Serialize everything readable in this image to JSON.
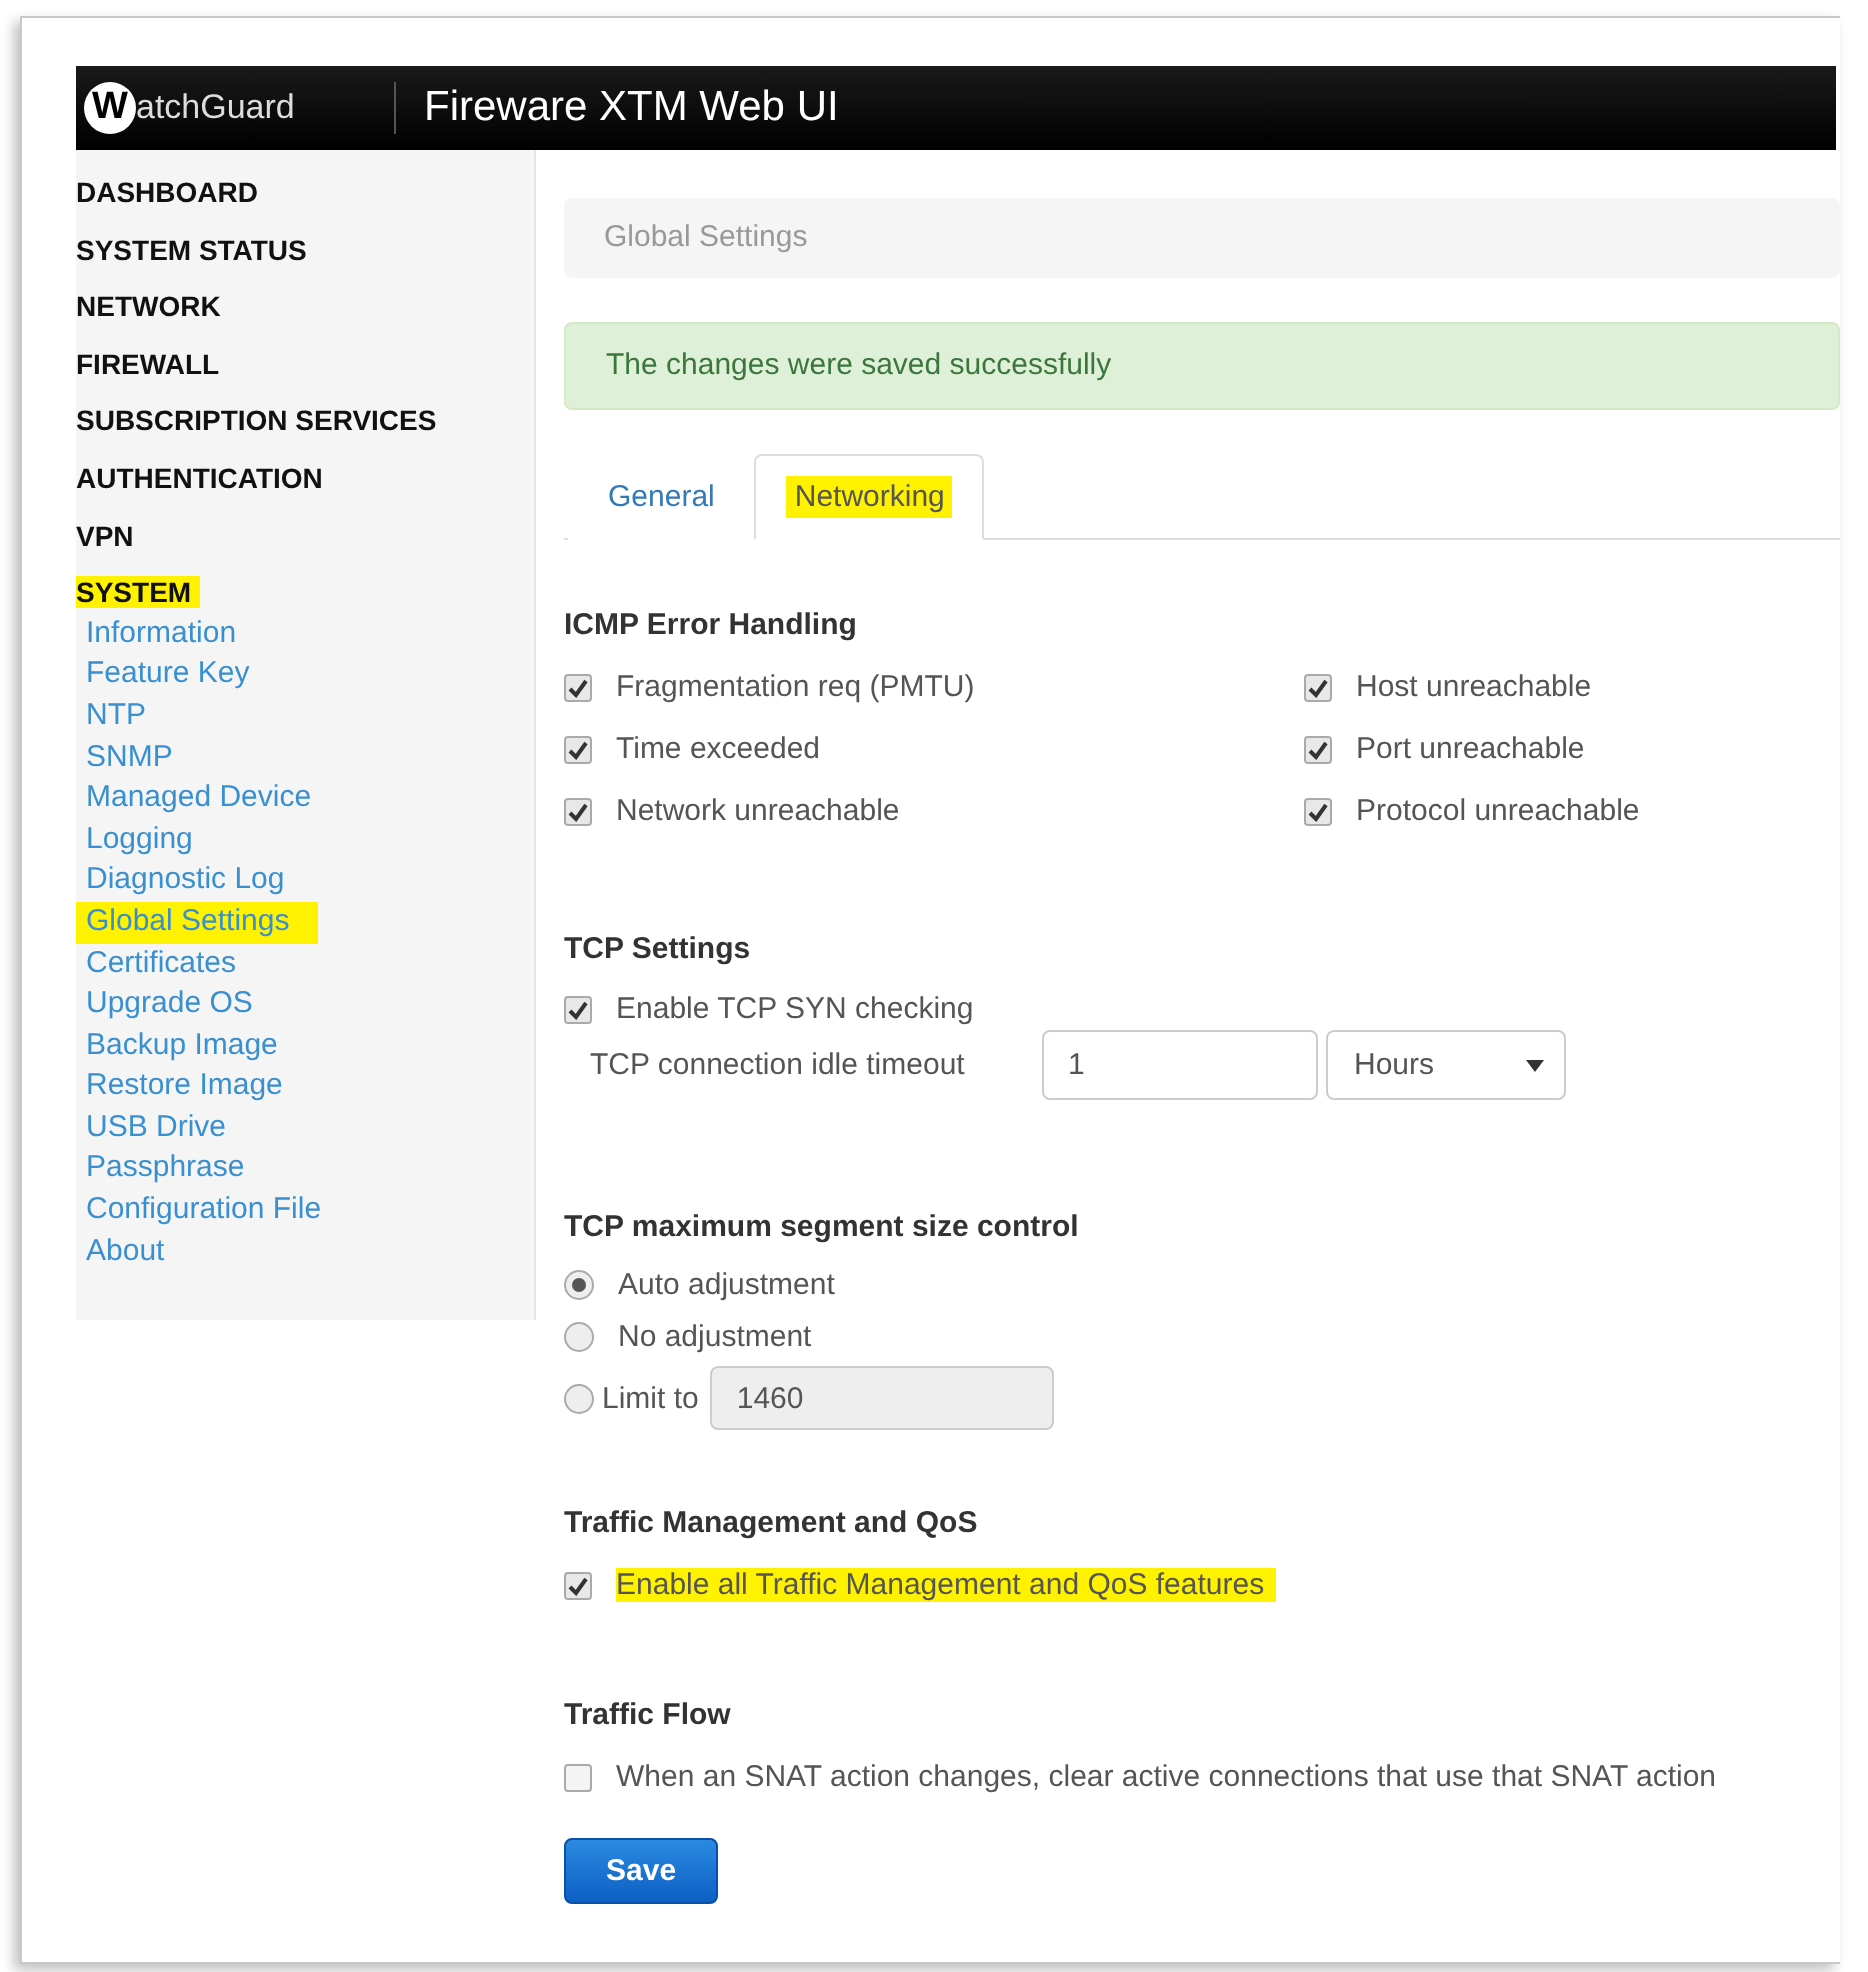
{
  "header": {
    "logo_mark": "W",
    "logo_text": "atchGuard",
    "title": "Fireware XTM Web UI"
  },
  "sidebar": {
    "sections": [
      {
        "label": "DASHBOARD",
        "highlighted": false
      },
      {
        "label": "SYSTEM STATUS",
        "highlighted": false
      },
      {
        "label": "NETWORK",
        "highlighted": false
      },
      {
        "label": "FIREWALL",
        "highlighted": false
      },
      {
        "label": "SUBSCRIPTION SERVICES",
        "highlighted": false
      },
      {
        "label": "AUTHENTICATION",
        "highlighted": false
      },
      {
        "label": "VPN",
        "highlighted": false
      },
      {
        "label": "SYSTEM",
        "highlighted": true,
        "items": [
          {
            "label": "Information",
            "selected": false
          },
          {
            "label": "Feature Key",
            "selected": false
          },
          {
            "label": "NTP",
            "selected": false
          },
          {
            "label": "SNMP",
            "selected": false
          },
          {
            "label": "Managed Device",
            "selected": false
          },
          {
            "label": "Logging",
            "selected": false
          },
          {
            "label": "Diagnostic Log",
            "selected": false
          },
          {
            "label": "Global Settings",
            "selected": true
          },
          {
            "label": "Certificates",
            "selected": false
          },
          {
            "label": "Upgrade OS",
            "selected": false
          },
          {
            "label": "Backup Image",
            "selected": false
          },
          {
            "label": "Restore Image",
            "selected": false
          },
          {
            "label": "USB Drive",
            "selected": false
          },
          {
            "label": "Passphrase",
            "selected": false
          },
          {
            "label": "Configuration File",
            "selected": false
          },
          {
            "label": "About",
            "selected": false
          }
        ]
      }
    ]
  },
  "breadcrumb": "Global Settings",
  "alert": "The changes were saved successfully",
  "tabs": [
    {
      "label": "General",
      "selected": false
    },
    {
      "label": "Networking",
      "selected": true
    }
  ],
  "icmp": {
    "heading": "ICMP Error Handling",
    "options": [
      {
        "label": "Fragmentation req (PMTU)",
        "checked": true
      },
      {
        "label": "Host unreachable",
        "checked": true
      },
      {
        "label": "Time exceeded",
        "checked": true
      },
      {
        "label": "Port unreachable",
        "checked": true
      },
      {
        "label": "Network unreachable",
        "checked": true
      },
      {
        "label": "Protocol unreachable",
        "checked": true
      }
    ]
  },
  "tcp": {
    "heading": "TCP Settings",
    "syn": {
      "label": "Enable TCP SYN checking",
      "checked": true
    },
    "timeout": {
      "label": "TCP connection idle timeout",
      "value": "1",
      "unit": "Hours"
    }
  },
  "mss": {
    "heading": "TCP maximum segment size control",
    "options": [
      {
        "label": "Auto adjustment",
        "selected": true
      },
      {
        "label": "No adjustment",
        "selected": false
      },
      {
        "label": "Limit to",
        "selected": false,
        "value": "1460",
        "disabled": true
      }
    ]
  },
  "qos": {
    "heading": "Traffic Management and QoS",
    "option": {
      "label": "Enable all Traffic Management and QoS features",
      "checked": true,
      "highlighted": true
    }
  },
  "flow": {
    "heading": "Traffic Flow",
    "option": {
      "label": "When an SNAT action changes, clear active connections that use that SNAT action",
      "checked": false,
      "highlighted": false
    }
  },
  "save": "Save"
}
